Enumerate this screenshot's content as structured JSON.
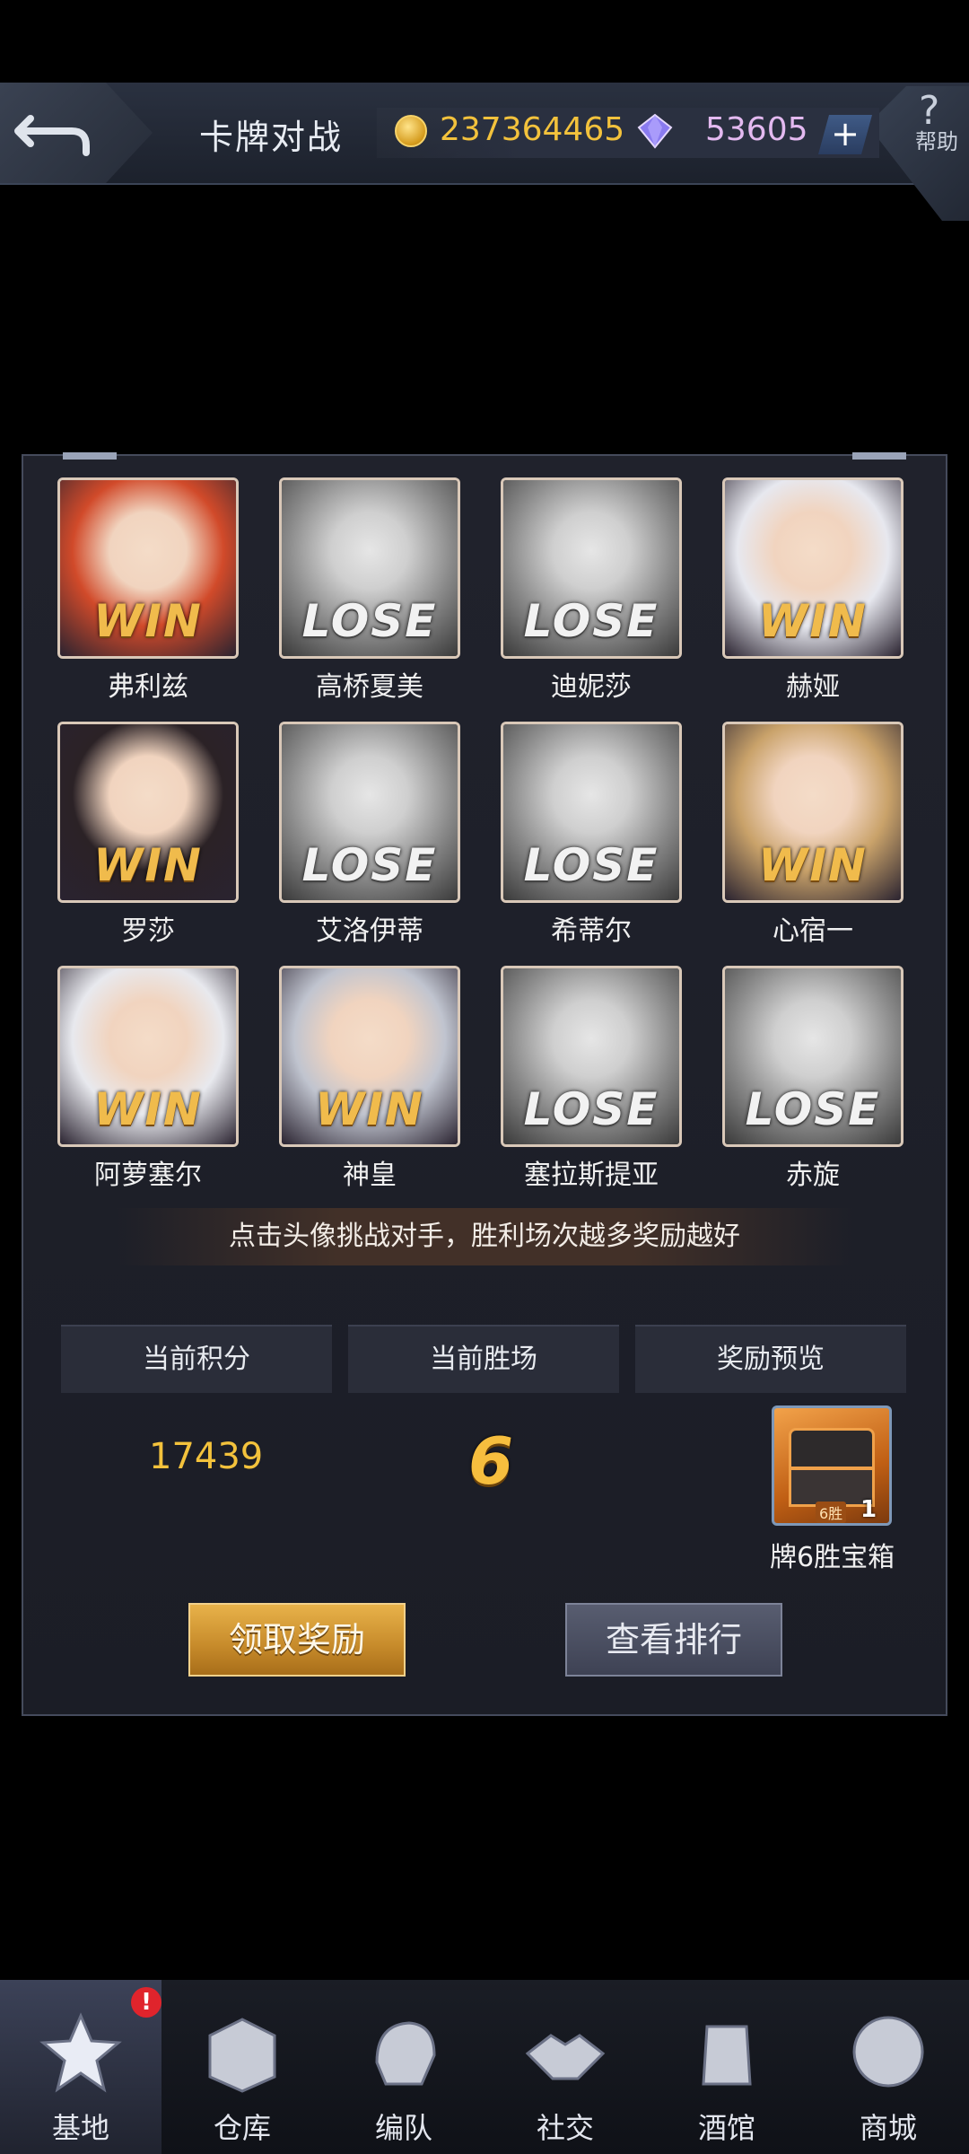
{
  "header": {
    "title": "卡牌对战",
    "gold": "237364465",
    "gems": "53605",
    "plus_label": "+",
    "help_symbol": "?",
    "help_label": "帮助"
  },
  "opponents": [
    {
      "name": "弗利兹",
      "result": "WIN"
    },
    {
      "name": "高桥夏美",
      "result": "LOSE"
    },
    {
      "name": "迪妮莎",
      "result": "LOSE"
    },
    {
      "name": "赫娅",
      "result": "WIN"
    },
    {
      "name": "罗莎",
      "result": "WIN"
    },
    {
      "name": "艾洛伊蒂",
      "result": "LOSE"
    },
    {
      "name": "希蒂尔",
      "result": "LOSE"
    },
    {
      "name": "心宿一",
      "result": "WIN"
    },
    {
      "name": "阿萝塞尔",
      "result": "WIN"
    },
    {
      "name": "神皇",
      "result": "WIN"
    },
    {
      "name": "塞拉斯提亚",
      "result": "LOSE"
    },
    {
      "name": "赤旋",
      "result": "LOSE"
    }
  ],
  "hint": "点击头像挑战对手，胜利场次越多奖励越好",
  "stats": {
    "score_label": "当前积分",
    "wins_label": "当前胜场",
    "reward_label": "奖励预览",
    "score_value": "17439",
    "wins_value": "6"
  },
  "reward": {
    "chest_tag": "6胜",
    "chest_count": "1",
    "chest_name": "牌6胜宝箱"
  },
  "buttons": {
    "claim": "领取奖励",
    "ranking": "查看排行"
  },
  "nav": {
    "items": [
      {
        "label": "基地",
        "icon": "base-emblem-icon",
        "active": true
      },
      {
        "label": "仓库",
        "icon": "warehouse-icon"
      },
      {
        "label": "编队",
        "icon": "formation-helmet-icon"
      },
      {
        "label": "社交",
        "icon": "handshake-icon"
      },
      {
        "label": "酒馆",
        "icon": "tavern-mug-icon"
      },
      {
        "label": "商城",
        "icon": "shop-robot-icon"
      }
    ],
    "badge": "!"
  },
  "colors": {
    "win": "#f0bb4c",
    "lose": "#f2f2f2",
    "gold": "#f3c23c",
    "panel": "#1b1d26"
  }
}
